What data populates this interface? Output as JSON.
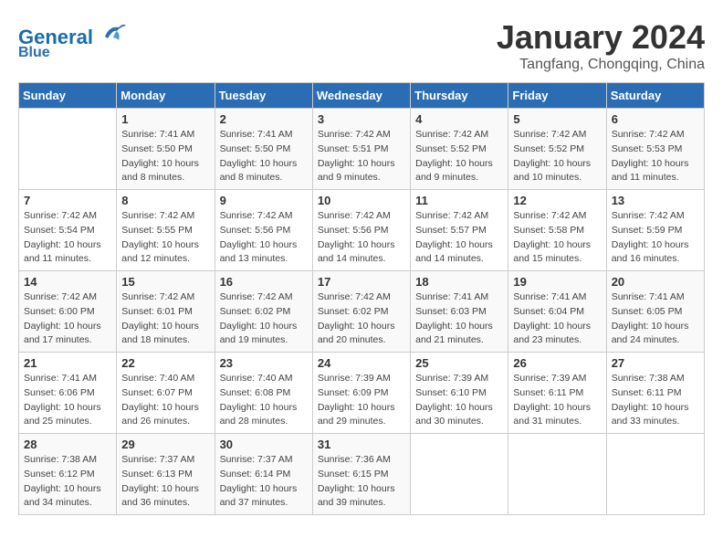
{
  "header": {
    "logo_line1": "General",
    "logo_line2": "Blue",
    "month": "January 2024",
    "location": "Tangfang, Chongqing, China"
  },
  "weekdays": [
    "Sunday",
    "Monday",
    "Tuesday",
    "Wednesday",
    "Thursday",
    "Friday",
    "Saturday"
  ],
  "weeks": [
    [
      {
        "day": "",
        "sunrise": "",
        "sunset": "",
        "daylight": ""
      },
      {
        "day": "1",
        "sunrise": "Sunrise: 7:41 AM",
        "sunset": "Sunset: 5:50 PM",
        "daylight": "Daylight: 10 hours and 8 minutes."
      },
      {
        "day": "2",
        "sunrise": "Sunrise: 7:41 AM",
        "sunset": "Sunset: 5:50 PM",
        "daylight": "Daylight: 10 hours and 8 minutes."
      },
      {
        "day": "3",
        "sunrise": "Sunrise: 7:42 AM",
        "sunset": "Sunset: 5:51 PM",
        "daylight": "Daylight: 10 hours and 9 minutes."
      },
      {
        "day": "4",
        "sunrise": "Sunrise: 7:42 AM",
        "sunset": "Sunset: 5:52 PM",
        "daylight": "Daylight: 10 hours and 9 minutes."
      },
      {
        "day": "5",
        "sunrise": "Sunrise: 7:42 AM",
        "sunset": "Sunset: 5:52 PM",
        "daylight": "Daylight: 10 hours and 10 minutes."
      },
      {
        "day": "6",
        "sunrise": "Sunrise: 7:42 AM",
        "sunset": "Sunset: 5:53 PM",
        "daylight": "Daylight: 10 hours and 11 minutes."
      }
    ],
    [
      {
        "day": "7",
        "sunrise": "Sunrise: 7:42 AM",
        "sunset": "Sunset: 5:54 PM",
        "daylight": "Daylight: 10 hours and 11 minutes."
      },
      {
        "day": "8",
        "sunrise": "Sunrise: 7:42 AM",
        "sunset": "Sunset: 5:55 PM",
        "daylight": "Daylight: 10 hours and 12 minutes."
      },
      {
        "day": "9",
        "sunrise": "Sunrise: 7:42 AM",
        "sunset": "Sunset: 5:56 PM",
        "daylight": "Daylight: 10 hours and 13 minutes."
      },
      {
        "day": "10",
        "sunrise": "Sunrise: 7:42 AM",
        "sunset": "Sunset: 5:56 PM",
        "daylight": "Daylight: 10 hours and 14 minutes."
      },
      {
        "day": "11",
        "sunrise": "Sunrise: 7:42 AM",
        "sunset": "Sunset: 5:57 PM",
        "daylight": "Daylight: 10 hours and 14 minutes."
      },
      {
        "day": "12",
        "sunrise": "Sunrise: 7:42 AM",
        "sunset": "Sunset: 5:58 PM",
        "daylight": "Daylight: 10 hours and 15 minutes."
      },
      {
        "day": "13",
        "sunrise": "Sunrise: 7:42 AM",
        "sunset": "Sunset: 5:59 PM",
        "daylight": "Daylight: 10 hours and 16 minutes."
      }
    ],
    [
      {
        "day": "14",
        "sunrise": "Sunrise: 7:42 AM",
        "sunset": "Sunset: 6:00 PM",
        "daylight": "Daylight: 10 hours and 17 minutes."
      },
      {
        "day": "15",
        "sunrise": "Sunrise: 7:42 AM",
        "sunset": "Sunset: 6:01 PM",
        "daylight": "Daylight: 10 hours and 18 minutes."
      },
      {
        "day": "16",
        "sunrise": "Sunrise: 7:42 AM",
        "sunset": "Sunset: 6:02 PM",
        "daylight": "Daylight: 10 hours and 19 minutes."
      },
      {
        "day": "17",
        "sunrise": "Sunrise: 7:42 AM",
        "sunset": "Sunset: 6:02 PM",
        "daylight": "Daylight: 10 hours and 20 minutes."
      },
      {
        "day": "18",
        "sunrise": "Sunrise: 7:41 AM",
        "sunset": "Sunset: 6:03 PM",
        "daylight": "Daylight: 10 hours and 21 minutes."
      },
      {
        "day": "19",
        "sunrise": "Sunrise: 7:41 AM",
        "sunset": "Sunset: 6:04 PM",
        "daylight": "Daylight: 10 hours and 23 minutes."
      },
      {
        "day": "20",
        "sunrise": "Sunrise: 7:41 AM",
        "sunset": "Sunset: 6:05 PM",
        "daylight": "Daylight: 10 hours and 24 minutes."
      }
    ],
    [
      {
        "day": "21",
        "sunrise": "Sunrise: 7:41 AM",
        "sunset": "Sunset: 6:06 PM",
        "daylight": "Daylight: 10 hours and 25 minutes."
      },
      {
        "day": "22",
        "sunrise": "Sunrise: 7:40 AM",
        "sunset": "Sunset: 6:07 PM",
        "daylight": "Daylight: 10 hours and 26 minutes."
      },
      {
        "day": "23",
        "sunrise": "Sunrise: 7:40 AM",
        "sunset": "Sunset: 6:08 PM",
        "daylight": "Daylight: 10 hours and 28 minutes."
      },
      {
        "day": "24",
        "sunrise": "Sunrise: 7:39 AM",
        "sunset": "Sunset: 6:09 PM",
        "daylight": "Daylight: 10 hours and 29 minutes."
      },
      {
        "day": "25",
        "sunrise": "Sunrise: 7:39 AM",
        "sunset": "Sunset: 6:10 PM",
        "daylight": "Daylight: 10 hours and 30 minutes."
      },
      {
        "day": "26",
        "sunrise": "Sunrise: 7:39 AM",
        "sunset": "Sunset: 6:11 PM",
        "daylight": "Daylight: 10 hours and 31 minutes."
      },
      {
        "day": "27",
        "sunrise": "Sunrise: 7:38 AM",
        "sunset": "Sunset: 6:11 PM",
        "daylight": "Daylight: 10 hours and 33 minutes."
      }
    ],
    [
      {
        "day": "28",
        "sunrise": "Sunrise: 7:38 AM",
        "sunset": "Sunset: 6:12 PM",
        "daylight": "Daylight: 10 hours and 34 minutes."
      },
      {
        "day": "29",
        "sunrise": "Sunrise: 7:37 AM",
        "sunset": "Sunset: 6:13 PM",
        "daylight": "Daylight: 10 hours and 36 minutes."
      },
      {
        "day": "30",
        "sunrise": "Sunrise: 7:37 AM",
        "sunset": "Sunset: 6:14 PM",
        "daylight": "Daylight: 10 hours and 37 minutes."
      },
      {
        "day": "31",
        "sunrise": "Sunrise: 7:36 AM",
        "sunset": "Sunset: 6:15 PM",
        "daylight": "Daylight: 10 hours and 39 minutes."
      },
      {
        "day": "",
        "sunrise": "",
        "sunset": "",
        "daylight": ""
      },
      {
        "day": "",
        "sunrise": "",
        "sunset": "",
        "daylight": ""
      },
      {
        "day": "",
        "sunrise": "",
        "sunset": "",
        "daylight": ""
      }
    ]
  ]
}
